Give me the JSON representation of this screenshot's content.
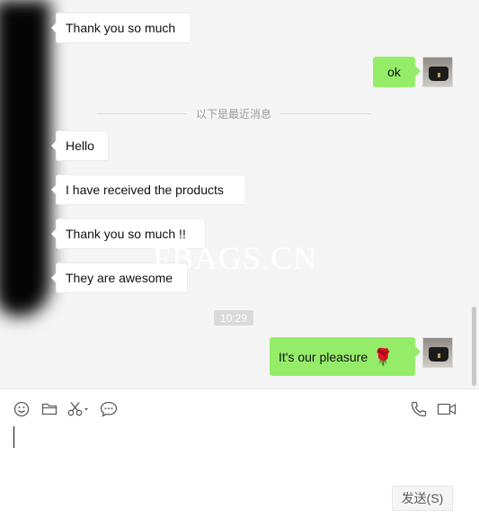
{
  "messages": {
    "m1": "Thank you so much",
    "m2": "ok",
    "m3": "Hello",
    "m4": "I have received the products",
    "m5": "Thank you so much !!",
    "m6": "They are awesome",
    "m7": "It's our pleasure",
    "m7_emoji": "🌹"
  },
  "divider_text": "以下是最近消息",
  "timestamp": "10:29",
  "watermark": "FBAGS.CN",
  "toolbar": {
    "icons": [
      "emoji-icon",
      "folder-icon",
      "scissors-icon",
      "chat-history-icon",
      "phone-icon",
      "video-icon"
    ]
  },
  "input_value": "",
  "send_label": "发送(S)",
  "colors": {
    "outgoing_bubble": "#95ec69",
    "incoming_bubble": "#ffffff",
    "chat_background": "#f5f5f5"
  }
}
